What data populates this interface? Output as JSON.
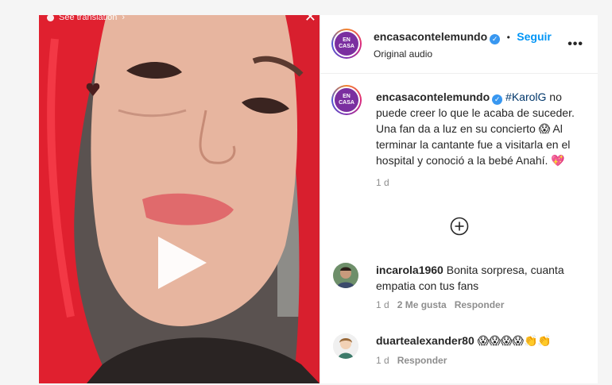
{
  "media": {
    "see_translation": "See translation",
    "close_glyph": "✕"
  },
  "header": {
    "username": "encasacontelemundo",
    "separator": "•",
    "follow_label": "Seguir",
    "audio_label": "Original audio",
    "more_glyph": "•••",
    "avatar_logo": "EN CASA"
  },
  "caption": {
    "username": "encasacontelemundo",
    "hashtag": "#KarolG",
    "text_1": " no puede creer lo que le acaba de suceder. Una fan da a luz en su concierto ",
    "emoji_1": "😱",
    "text_2": " Al terminar la cantante fue a visitarla en el hospital y conoció a la bebé Anahí. ",
    "emoji_2": "💖",
    "time": "1 d"
  },
  "comments": [
    {
      "username": "incarola1960",
      "text": "Bonita sorpresa, cuanta empatia con tus fans",
      "time": "1 d",
      "likes": "2 Me gusta",
      "reply": "Responder"
    },
    {
      "username": "duartealexander80",
      "text": "😱😱😱😱👏👏",
      "time": "1 d",
      "reply": "Responder"
    }
  ],
  "colors": {
    "accent": "#0095f6",
    "verified": "#3897f0",
    "hair": "#e8283a"
  }
}
